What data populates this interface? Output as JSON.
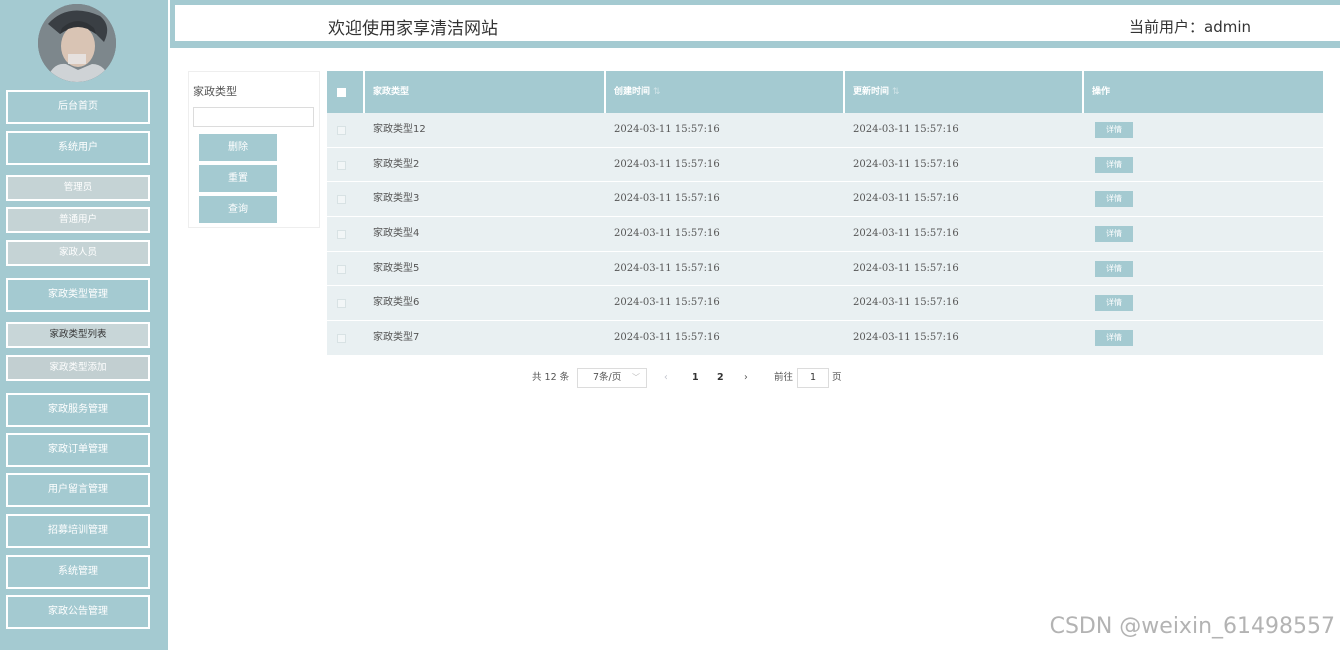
{
  "header": {
    "title": "欢迎使用家享清洁网站",
    "user_label": "当前用户：admin"
  },
  "sidebar": {
    "items": [
      {
        "label": "后台首页",
        "type": "menu"
      },
      {
        "label": "系统用户",
        "type": "menu"
      },
      {
        "label": "管理员",
        "type": "sub"
      },
      {
        "label": "普通用户",
        "type": "sub"
      },
      {
        "label": "家政人员",
        "type": "sub"
      },
      {
        "label": "家政类型管理",
        "type": "menu"
      },
      {
        "label": "家政类型列表",
        "type": "sub"
      },
      {
        "label": "家政类型添加",
        "type": "sub"
      },
      {
        "label": "家政服务管理",
        "type": "menu"
      },
      {
        "label": "家政订单管理",
        "type": "menu"
      },
      {
        "label": "用户留言管理",
        "type": "menu"
      },
      {
        "label": "招募培训管理",
        "type": "menu"
      },
      {
        "label": "系统管理",
        "type": "menu"
      },
      {
        "label": "家政公告管理",
        "type": "menu"
      }
    ]
  },
  "search": {
    "label": "家政类型",
    "value": "",
    "delete_label": "删除",
    "reset_label": "重置",
    "query_label": "查询"
  },
  "table": {
    "columns": [
      "家政类型",
      "创建时间",
      "更新时间",
      "操作"
    ],
    "rows": [
      {
        "type": "家政类型12",
        "created": "2024-03-11 15:57:16",
        "updated": "2024-03-11 15:57:16",
        "action": "详情"
      },
      {
        "type": "家政类型2",
        "created": "2024-03-11 15:57:16",
        "updated": "2024-03-11 15:57:16",
        "action": "详情"
      },
      {
        "type": "家政类型3",
        "created": "2024-03-11 15:57:16",
        "updated": "2024-03-11 15:57:16",
        "action": "详情"
      },
      {
        "type": "家政类型4",
        "created": "2024-03-11 15:57:16",
        "updated": "2024-03-11 15:57:16",
        "action": "详情"
      },
      {
        "type": "家政类型5",
        "created": "2024-03-11 15:57:16",
        "updated": "2024-03-11 15:57:16",
        "action": "详情"
      },
      {
        "type": "家政类型6",
        "created": "2024-03-11 15:57:16",
        "updated": "2024-03-11 15:57:16",
        "action": "详情"
      },
      {
        "type": "家政类型7",
        "created": "2024-03-11 15:57:16",
        "updated": "2024-03-11 15:57:16",
        "action": "详情"
      }
    ]
  },
  "pagination": {
    "total": "共 12 条",
    "page_size": "7条/页",
    "pages": [
      "1",
      "2"
    ],
    "goto_label": "前往",
    "current_page": "1",
    "page_suffix": "页"
  },
  "watermark": "CSDN @weixin_61498557",
  "colors": {
    "accent": "#a4cad1",
    "row_bg": "#e9f0f2"
  }
}
